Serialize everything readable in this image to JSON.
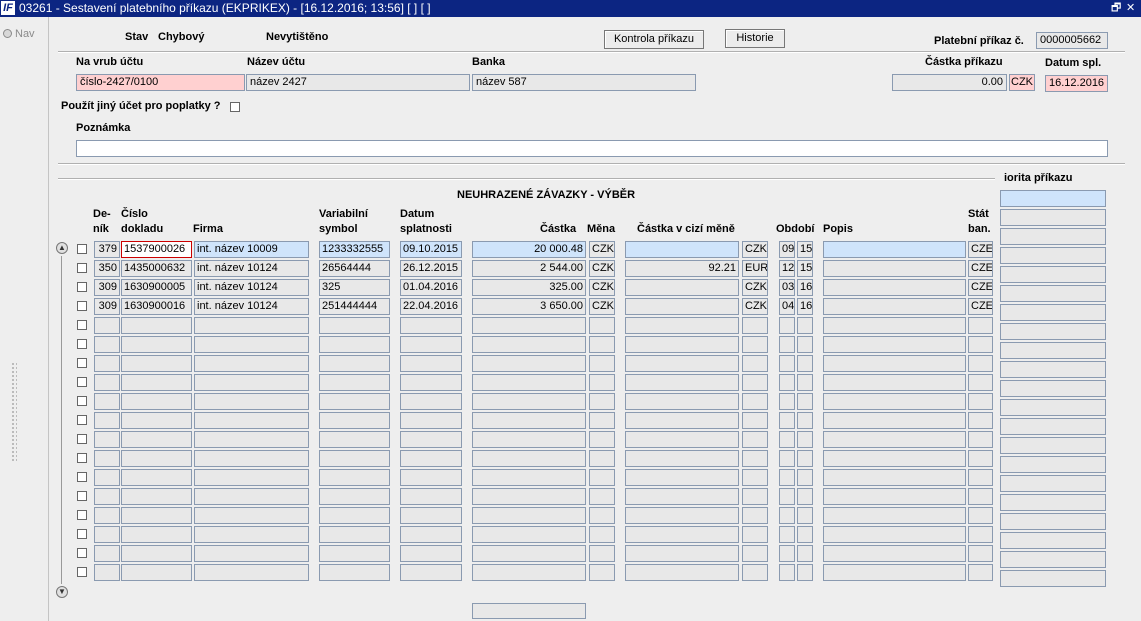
{
  "window": {
    "logo": "IF",
    "title": "03261 - Sestavení platebního příkazu (EKPRIKEX) - [16.12.2016; 13:56]  [ ]  [ ]",
    "btn_restore": "🗗",
    "btn_close": "✕"
  },
  "nav": {
    "label": "Nav"
  },
  "header": {
    "stav_label": "Stav",
    "stav_value": "Chybový",
    "print_status": "Nevytištěno",
    "kontrola_button": "Kontrola příkazu",
    "historie_button": "Historie",
    "platebni_prikaz_label": "Platební příkaz č.",
    "platebni_prikaz_value": "0000005662"
  },
  "account": {
    "na_vrub_label": "Na vrub účtu",
    "na_vrub_value": "číslo-2427/0100",
    "nazev_uctu_label": "Název účtu",
    "nazev_uctu_value": "název 2427",
    "banka_label": "Banka",
    "banka_value": "název 587",
    "castka_prikazu_label": "Částka příkazu",
    "castka_prikazu_value": "0.00",
    "currency": "CZK",
    "datum_spl_label": "Datum spl.",
    "datum_spl_value": "16.12.2016",
    "jiny_ucet_label": "Použít jiný účet pro poplatky ?",
    "poznamka_label": "Poznámka",
    "poznamka_value": ""
  },
  "section": {
    "title": "NEUHRAZENÉ ZÁVAZKY - VÝBĚR",
    "priorita_label": "iorita příkazu"
  },
  "table": {
    "headers": {
      "denik": "De-\nník",
      "cislo": "Číslo\ndokladu",
      "firma": "Firma",
      "vs": "Variabilní\nsymbol",
      "datum": "Datum\nsplatnosti",
      "castka": "Částka",
      "mena": "Měna",
      "castka_cizi": "Částka v cizí měně",
      "obdobi": "Období",
      "popis": "Popis",
      "stat": "Stát\nban."
    },
    "rows": [
      {
        "denik": "379",
        "cislo": "1537900026",
        "firma": "int. název 10009",
        "vs": "1233332555",
        "datum": "09.10.2015",
        "castka": "20 000.48",
        "mena": "CZK",
        "castka_cizi": "",
        "mena_cizi": "CZK",
        "obd1": "09",
        "obd2": "15",
        "popis": "",
        "stat": "CZE"
      },
      {
        "denik": "350",
        "cislo": "1435000632",
        "firma": "int. název 10124",
        "vs": "26564444",
        "datum": "26.12.2015",
        "castka": "2 544.00",
        "mena": "CZK",
        "castka_cizi": "92.21",
        "mena_cizi": "EUR",
        "obd1": "12",
        "obd2": "15",
        "popis": "",
        "stat": "CZE"
      },
      {
        "denik": "309",
        "cislo": "1630900005",
        "firma": "int. název 10124",
        "vs": "325",
        "datum": "01.04.2016",
        "castka": "325.00",
        "mena": "CZK",
        "castka_cizi": "",
        "mena_cizi": "CZK",
        "obd1": "03",
        "obd2": "16",
        "popis": "",
        "stat": "CZE"
      },
      {
        "denik": "309",
        "cislo": "1630900016",
        "firma": "int. název 10124",
        "vs": "251444444",
        "datum": "22.04.2016",
        "castka": "3 650.00",
        "mena": "CZK",
        "castka_cizi": "",
        "mena_cizi": "CZK",
        "obd1": "04",
        "obd2": "16",
        "popis": "",
        "stat": "CZE"
      }
    ],
    "empty_row_count": 14
  },
  "colors": {
    "titlebar": "#0c2582",
    "highlight_row": "#cfe4fb",
    "required_field": "#ffd0d0",
    "active_cell_border": "#cc0000"
  }
}
